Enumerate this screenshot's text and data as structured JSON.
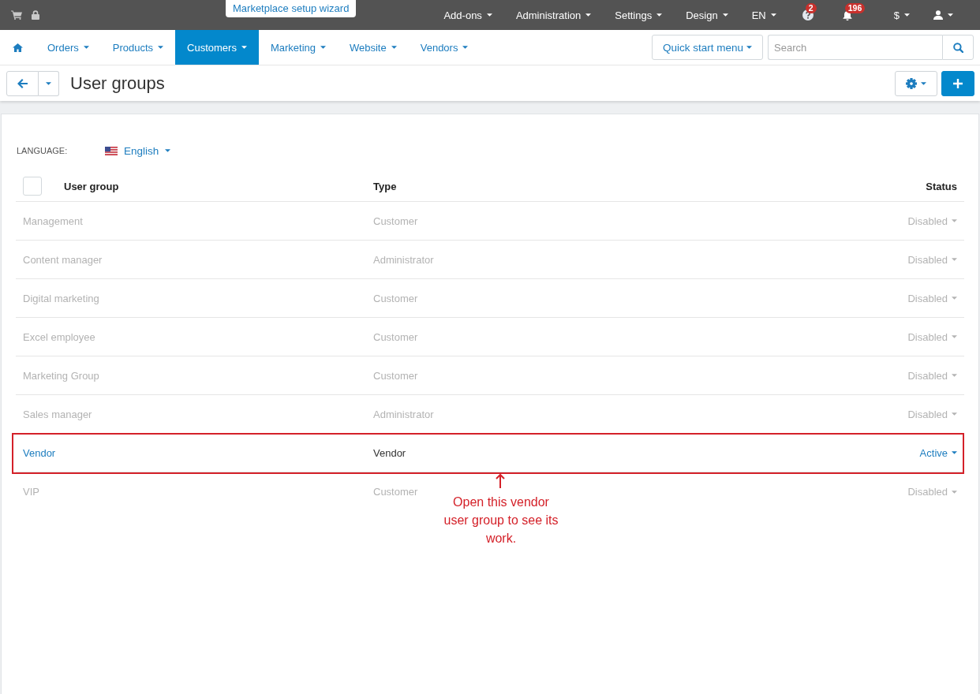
{
  "top_bar": {
    "wizard_link": "Marketplace setup wizard",
    "items": [
      {
        "kind": "menu",
        "label": "Add-ons"
      },
      {
        "kind": "menu",
        "label": "Administration"
      },
      {
        "kind": "menu",
        "label": "Settings"
      },
      {
        "kind": "menu",
        "label": "Design"
      },
      {
        "kind": "menu",
        "label": "EN"
      },
      {
        "kind": "help",
        "badge": "2"
      },
      {
        "kind": "notifications",
        "badge": "196"
      },
      {
        "kind": "menu",
        "label": "$"
      },
      {
        "kind": "account"
      }
    ]
  },
  "nav": {
    "tabs": [
      {
        "label": "Orders",
        "selected": false
      },
      {
        "label": "Products",
        "selected": false
      },
      {
        "label": "Customers",
        "selected": true
      },
      {
        "label": "Marketing",
        "selected": false
      },
      {
        "label": "Website",
        "selected": false
      },
      {
        "label": "Vendors",
        "selected": false
      }
    ],
    "quick_start_button": "Quick start menu",
    "search": {
      "placeholder": "Search"
    }
  },
  "page_header": {
    "title": "User groups"
  },
  "language": {
    "label": "LANGUAGE:",
    "value": "English"
  },
  "table": {
    "header_checkbox": {
      "checked": false
    },
    "columns": [
      "User group",
      "Type",
      "Status"
    ],
    "rows": [
      {
        "name": "Management",
        "type": "Customer",
        "status": "Disabled",
        "disabled": true,
        "highlighted": false
      },
      {
        "name": "Content manager",
        "type": "Administrator",
        "status": "Disabled",
        "disabled": true,
        "highlighted": false
      },
      {
        "name": "Digital marketing",
        "type": "Customer",
        "status": "Disabled",
        "disabled": true,
        "highlighted": false
      },
      {
        "name": "Excel employee",
        "type": "Customer",
        "status": "Disabled",
        "disabled": true,
        "highlighted": false
      },
      {
        "name": "Marketing Group",
        "type": "Customer",
        "status": "Disabled",
        "disabled": true,
        "highlighted": false
      },
      {
        "name": "Sales manager",
        "type": "Administrator",
        "status": "Disabled",
        "disabled": true,
        "highlighted": false
      },
      {
        "name": "Vendor",
        "type": "Vendor",
        "status": "Active",
        "disabled": false,
        "highlighted": true
      },
      {
        "name": "VIP",
        "type": "Customer",
        "status": "Disabled",
        "disabled": true,
        "highlighted": false
      }
    ]
  },
  "annotation": {
    "text": "Open this vendor user group to see its work."
  }
}
